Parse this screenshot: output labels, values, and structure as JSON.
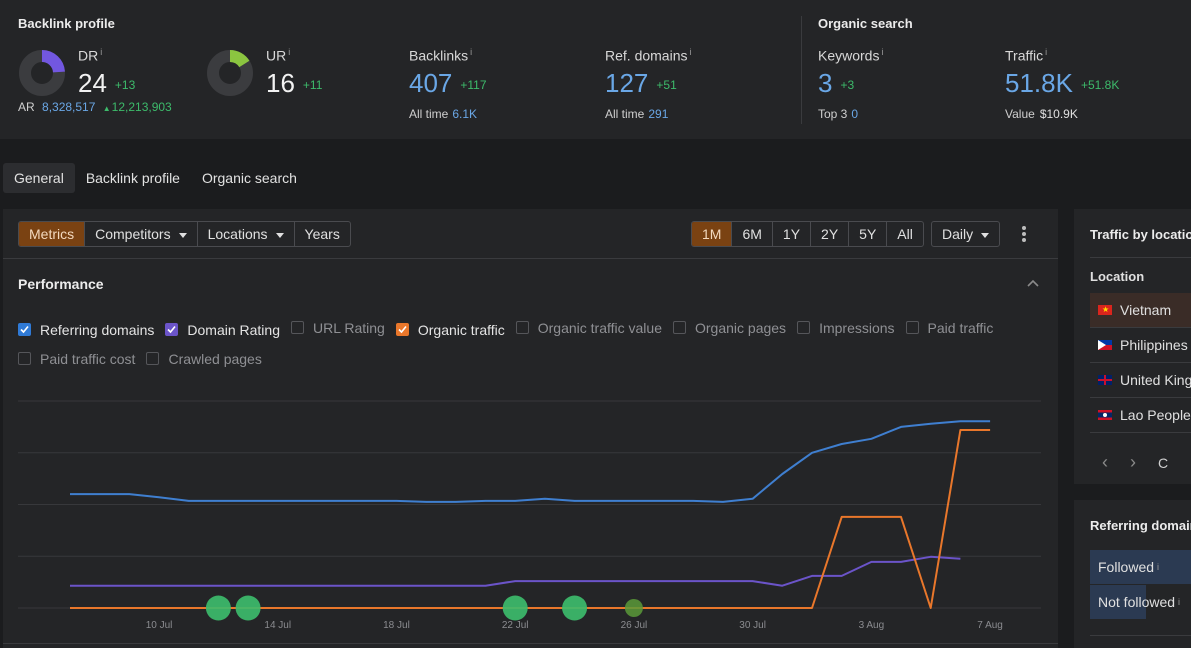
{
  "backlink_profile": {
    "title": "Backlink profile",
    "dr": {
      "label": "DR",
      "info": "i",
      "value": "24",
      "delta": "+13",
      "gauge_fraction": 0.24,
      "color": "#7257e0"
    },
    "ur": {
      "label": "UR",
      "info": "i",
      "value": "16",
      "delta": "+11",
      "gauge_fraction": 0.16,
      "color": "#8bc540"
    },
    "ar": {
      "label": "AR",
      "value": "8,328,517",
      "delta": "12,213,903",
      "delta_icon": "triangle-up-icon"
    },
    "backlinks": {
      "label": "Backlinks",
      "info": "i",
      "value": "407",
      "delta": "+117",
      "sub_label": "All time",
      "sub_value": "6.1K"
    },
    "ref_domains": {
      "label": "Ref. domains",
      "info": "i",
      "value": "127",
      "delta": "+51",
      "sub_label": "All time",
      "sub_value": "291"
    }
  },
  "organic_search": {
    "title": "Organic search",
    "keywords": {
      "label": "Keywords",
      "info": "i",
      "value": "3",
      "delta": "+3",
      "sub_label": "Top 3",
      "sub_value": "0"
    },
    "traffic": {
      "label": "Traffic",
      "info": "i",
      "value": "51.8K",
      "delta": "+51.8K",
      "sub_label": "Value",
      "sub_value": "$10.9K"
    }
  },
  "tabs": [
    {
      "label": "General",
      "active": true
    },
    {
      "label": "Backlink profile",
      "active": false
    },
    {
      "label": "Organic search",
      "active": false
    }
  ],
  "toolbar": {
    "view_buttons": [
      {
        "label": "Metrics",
        "active": true,
        "dropdown": false
      },
      {
        "label": "Competitors",
        "active": false,
        "dropdown": true
      },
      {
        "label": "Locations",
        "active": false,
        "dropdown": true
      },
      {
        "label": "Years",
        "active": false,
        "dropdown": false
      }
    ],
    "ranges": [
      {
        "label": "1M",
        "active": true
      },
      {
        "label": "6M",
        "active": false
      },
      {
        "label": "1Y",
        "active": false
      },
      {
        "label": "2Y",
        "active": false
      },
      {
        "label": "5Y",
        "active": false
      },
      {
        "label": "All",
        "active": false
      }
    ],
    "granularity": "Daily",
    "more_icon": "kebab-icon"
  },
  "performance": {
    "title": "Performance",
    "collapse_icon": "chevron-up-icon",
    "metrics": [
      {
        "label": "Referring domains",
        "checked": true,
        "color": "#2f7ad6"
      },
      {
        "label": "Domain Rating",
        "checked": true,
        "color": "#6b54c9"
      },
      {
        "label": "URL Rating",
        "checked": false
      },
      {
        "label": "Organic traffic",
        "checked": true,
        "color": "#e9772b"
      },
      {
        "label": "Organic traffic value",
        "checked": false
      },
      {
        "label": "Organic pages",
        "checked": false
      },
      {
        "label": "Impressions",
        "checked": false
      },
      {
        "label": "Paid traffic",
        "checked": false
      },
      {
        "label": "Paid traffic cost",
        "checked": false
      },
      {
        "label": "Crawled pages",
        "checked": false
      }
    ]
  },
  "chart_data": {
    "type": "line",
    "title": "Performance",
    "xlabel": "",
    "ylabel": "",
    "grid": true,
    "y_axis_labels_visible": false,
    "ylim": [
      0,
      4
    ],
    "y_units": "relative grid units (no axis labels shown)",
    "x": [
      "7 Jul",
      "8 Jul",
      "9 Jul",
      "10 Jul",
      "11 Jul",
      "12 Jul",
      "13 Jul",
      "14 Jul",
      "15 Jul",
      "16 Jul",
      "17 Jul",
      "18 Jul",
      "19 Jul",
      "20 Jul",
      "21 Jul",
      "22 Jul",
      "23 Jul",
      "24 Jul",
      "25 Jul",
      "26 Jul",
      "27 Jul",
      "28 Jul",
      "29 Jul",
      "30 Jul",
      "31 Jul",
      "1 Aug",
      "2 Aug",
      "3 Aug",
      "4 Aug",
      "5 Aug",
      "6 Aug",
      "7 Aug"
    ],
    "x_tick_labels": [
      "10 Jul",
      "14 Jul",
      "18 Jul",
      "22 Jul",
      "26 Jul",
      "30 Jul",
      "3 Aug",
      "7 Aug"
    ],
    "series": [
      {
        "name": "Referring domains",
        "color": "#3f7fd0",
        "values": [
          2.2,
          2.2,
          2.2,
          2.14,
          2.07,
          2.07,
          2.07,
          2.07,
          2.07,
          2.07,
          2.07,
          2.07,
          2.05,
          2.05,
          2.07,
          2.07,
          2.11,
          2.07,
          2.07,
          2.07,
          2.07,
          2.07,
          2.05,
          2.11,
          2.59,
          3.0,
          3.17,
          3.27,
          3.5,
          3.56,
          3.61,
          3.61
        ]
      },
      {
        "name": "Domain Rating",
        "color": "#6b54c9",
        "values": [
          0.43,
          0.43,
          0.43,
          0.43,
          0.43,
          0.43,
          0.43,
          0.43,
          0.43,
          0.43,
          0.43,
          0.43,
          0.43,
          0.43,
          0.43,
          0.52,
          0.52,
          0.52,
          0.52,
          0.52,
          0.52,
          0.52,
          0.52,
          0.52,
          0.43,
          0.62,
          0.62,
          0.89,
          0.89,
          0.99,
          0.95,
          null
        ]
      },
      {
        "name": "Organic traffic",
        "color": "#e9772b",
        "values": [
          0,
          0,
          0,
          0,
          0,
          0,
          0,
          0,
          0,
          0,
          0,
          0,
          0,
          0,
          0,
          0,
          0,
          0,
          0,
          0,
          0,
          0,
          0,
          0,
          0,
          0,
          1.76,
          1.76,
          1.76,
          0,
          3.44,
          3.44
        ]
      }
    ],
    "annotations": [
      {
        "x": "12 Jul",
        "type": "event-dot",
        "color": "#3dbb6b"
      },
      {
        "x": "13 Jul",
        "type": "event-dot",
        "color": "#3dbb6b"
      },
      {
        "x": "22 Jul",
        "type": "event-dot",
        "color": "#3dbb6b"
      },
      {
        "x": "24 Jul",
        "type": "event-dot",
        "color": "#3dbb6b"
      },
      {
        "x": "26 Jul",
        "type": "event-dot-small",
        "color": "#5a9a3a"
      }
    ],
    "legend": "none"
  },
  "traffic_by_location": {
    "title": "Traffic by location",
    "column": "Location",
    "rows": [
      {
        "name": "Vietnam",
        "flag": "vn-flag-icon",
        "highlighted": true
      },
      {
        "name": "Philippines",
        "flag": "ph-flag-icon",
        "highlighted": false
      },
      {
        "name": "United Kingdom",
        "flag": "gb-flag-icon",
        "highlighted": false
      },
      {
        "name": "Lao People's Democratic Republic",
        "flag": "la-flag-icon",
        "highlighted": false
      }
    ],
    "prev_icon": "chevron-left-icon",
    "next_icon": "chevron-right-icon",
    "more_label": "C"
  },
  "referring_domains": {
    "title": "Referring domains",
    "rows": [
      {
        "label": "Followed",
        "info": "i"
      },
      {
        "label": "Not followed",
        "info": "i"
      }
    ]
  }
}
